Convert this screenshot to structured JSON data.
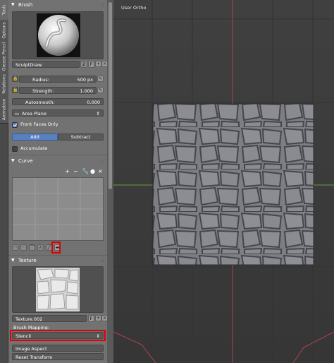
{
  "side_tabs": [
    "Tools",
    "Options",
    "Grease Pencil",
    "Relations",
    "Animation"
  ],
  "brush": {
    "section_title": "Brush",
    "name": "SculptDraw",
    "users": "2",
    "fake_user": "F",
    "radius_label": "Radius:",
    "radius_value": "500 px",
    "strength_label": "Strength:",
    "strength_value": "1.000",
    "autosmooth_label": "Autosmooth:",
    "autosmooth_value": "0.000",
    "plane": "Area Plane",
    "front_faces_label": "Front Faces Only",
    "add_label": "Add",
    "subtract_label": "Subtract",
    "accumulate_label": "Accumulate"
  },
  "curve": {
    "section_title": "Curve",
    "tool_icons": [
      "+",
      "−",
      "wrench",
      "●",
      "×"
    ]
  },
  "texture": {
    "section_title": "Texture",
    "name": "Texture.002",
    "fake_user": "F",
    "mapping_label": "Brush Mapping:",
    "mapping_value": "Stencil",
    "image_aspect_label": "Image Aspect",
    "reset_transform_label": "Reset Transform"
  },
  "viewport": {
    "label": "User Ortho"
  },
  "colors": {
    "highlight": "#e00000",
    "accent": "#5680c2",
    "grid_x": "#b3434b",
    "grid_y": "#6b9a3b"
  }
}
